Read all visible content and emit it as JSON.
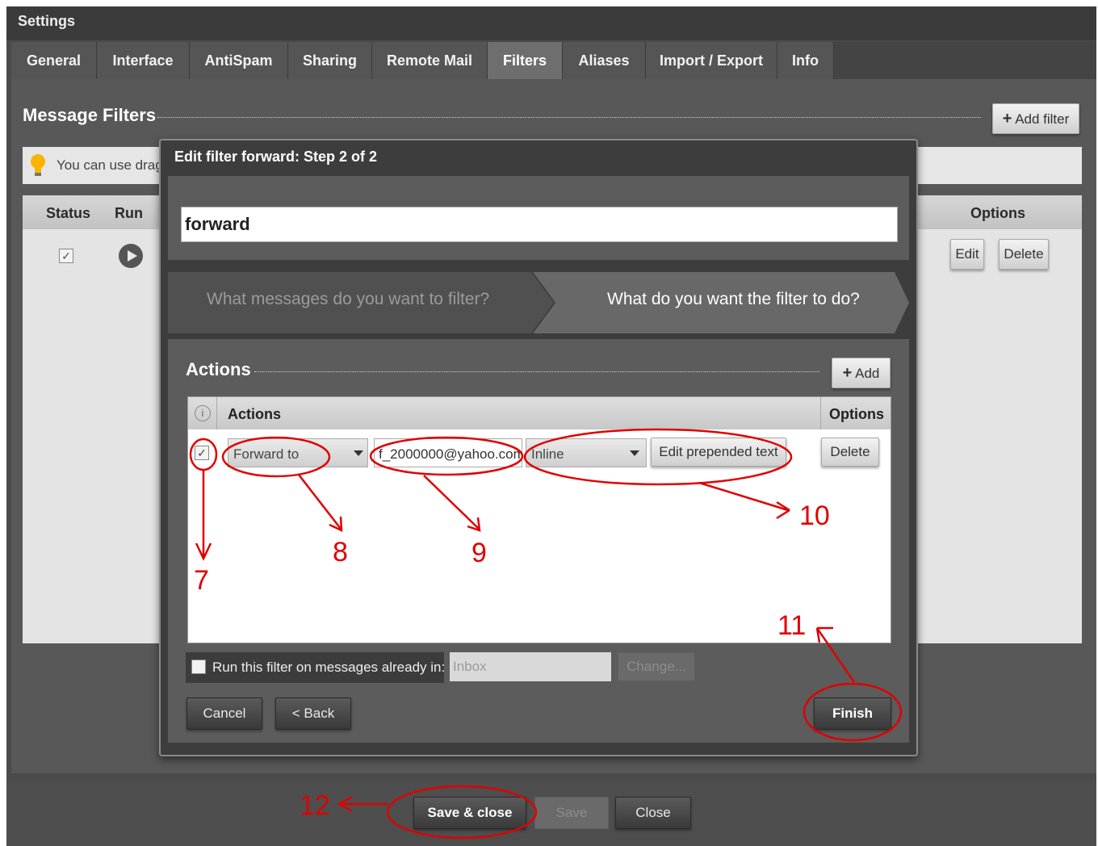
{
  "window": {
    "title": "Settings"
  },
  "tabs": [
    {
      "label": "General"
    },
    {
      "label": "Interface"
    },
    {
      "label": "AntiSpam"
    },
    {
      "label": "Sharing"
    },
    {
      "label": "Remote Mail"
    },
    {
      "label": "Filters"
    },
    {
      "label": "Aliases"
    },
    {
      "label": "Import / Export"
    },
    {
      "label": "Info"
    }
  ],
  "message_filters": {
    "title": "Message Filters",
    "add_filter_label": "Add filter",
    "hint": "You can use drag",
    "columns": {
      "status": "Status",
      "run": "Run",
      "options": "Options"
    },
    "row": {
      "edit_label": "Edit",
      "delete_label": "Delete"
    }
  },
  "modal": {
    "title": "Edit filter forward: Step 2 of 2",
    "filter_name": "forward",
    "step1": "What messages do you want to filter?",
    "step2": "What do you want the filter to do?",
    "actions_title": "Actions",
    "add_label": "Add",
    "table_header": {
      "actions": "Actions",
      "options": "Options"
    },
    "action_row": {
      "action_type": "Forward to",
      "email": "f_2000000@yahoo.com",
      "format": "Inline",
      "edit_prepended_label": "Edit prepended text",
      "delete_label": "Delete"
    },
    "run_label": "Run this filter on messages already in:",
    "folder_value": "Inbox",
    "change_label": "Change...",
    "cancel_label": "Cancel",
    "back_label": "< Back",
    "finish_label": "Finish"
  },
  "footer": {
    "save_close_label": "Save & close",
    "save_label": "Save",
    "close_label": "Close"
  },
  "annotations": [
    "7",
    "8",
    "9",
    "10",
    "11",
    "12"
  ],
  "colors": {
    "annotation": "#e00000",
    "dark_panel": "#3d3d3d"
  }
}
